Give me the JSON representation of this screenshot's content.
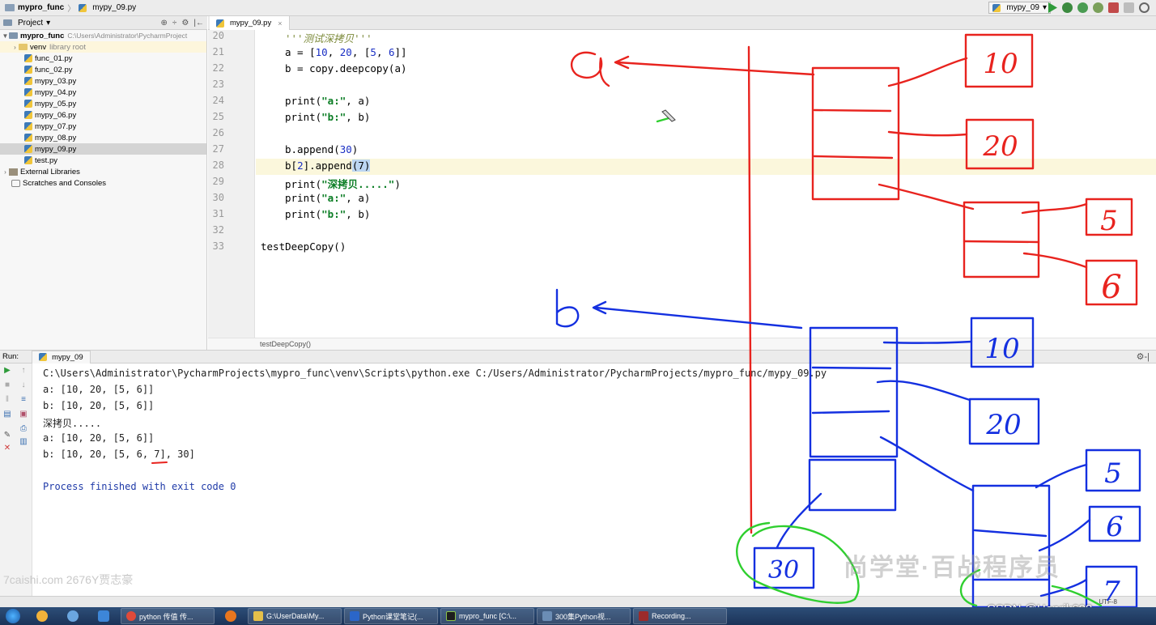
{
  "topbar": {
    "crumbs": [
      "mypro_func",
      "mypy_09.py"
    ],
    "run_config": "mypy_09",
    "run_config_arrow": "▾"
  },
  "project": {
    "header_label": "Project",
    "header_arrow": "▾",
    "tools": [
      "⊕",
      "÷",
      "⚙",
      "|←"
    ],
    "root_name": "mypro_func",
    "root_path": "C:\\Users\\Administrator\\PycharmProject",
    "venv_name": "venv",
    "venv_note": "library root",
    "files": [
      "func_01.py",
      "func_02.py",
      "mypy_03.py",
      "mypy_04.py",
      "mypy_05.py",
      "mypy_06.py",
      "mypy_07.py",
      "mypy_08.py",
      "mypy_09.py",
      "test.py"
    ],
    "external_libraries": "External Libraries",
    "scratches": "Scratches and Consoles"
  },
  "editor": {
    "tab_label": "mypy_09.py",
    "tab_close": "×",
    "line_numbers": [
      "20",
      "21",
      "22",
      "23",
      "24",
      "25",
      "26",
      "27",
      "28",
      "29",
      "30",
      "31",
      "32",
      "33"
    ],
    "code": {
      "l20": "'''测试深拷贝'''",
      "l21_a": "a = [",
      "l21_n1": "10",
      "l21_s1": ", ",
      "l21_n2": "20",
      "l21_s2": ", [",
      "l21_n3": "5",
      "l21_s3": ", ",
      "l21_n4": "6",
      "l21_end": "]]",
      "l22": "b = copy.deepcopy(a)",
      "l24_a": "print(",
      "l24_str": "\"a:\"",
      "l24_end": ", a)",
      "l25_a": "print(",
      "l25_str": "\"b:\"",
      "l25_end": ", b)",
      "l27_a": "b.append(",
      "l27_n": "30",
      "l27_end": ")",
      "l28_a": "b[",
      "l28_n": "2",
      "l28_b": "].append",
      "l28_sel": "(7)",
      "l29_a": "print(",
      "l29_str": "\"深拷贝.....\"",
      "l29_end": ")",
      "l30_a": "print(",
      "l30_str": "\"a:\"",
      "l30_end": ", a)",
      "l31_a": "print(",
      "l31_str": "\"b:\"",
      "l31_end": ", b)",
      "l33": "testDeepCopy()"
    },
    "breadcrumb": "testDeepCopy()"
  },
  "run": {
    "label": "Run:",
    "tab": "mypy_09",
    "gear": "⚙-|",
    "output": [
      "C:\\Users\\Administrator\\PycharmProjects\\mypro_func\\venv\\Scripts\\python.exe C:/Users/Administrator/PycharmProjects/mypro_func/mypy_09.py",
      "a: [10, 20, [5, 6]]",
      "b: [10, 20, [5, 6]]",
      "深拷贝.....",
      "a: [10, 20, [5, 6]]",
      "b: [10, 20, [5, 6, 7], 30]",
      "",
      "Process finished with exit code 0"
    ]
  },
  "annotations": {
    "label_a": "a",
    "label_b": "b",
    "red_values": [
      "10",
      "20",
      "5",
      "6"
    ],
    "blue_values": [
      "10",
      "20",
      "5",
      "6",
      "7"
    ],
    "green_value": "30"
  },
  "watermarks": {
    "left": "7caishi.com 2676Y贾志豪",
    "center": "尚学堂·百战程序员",
    "csdn": "CSDN @Henrik698",
    "status_text": "UTF-8"
  },
  "taskbar": {
    "tasks": [
      {
        "label": "python 传值 传...",
        "color": "#e04a3a"
      },
      {
        "label": "G:\\UserData\\My...",
        "color": "#e5c04a"
      },
      {
        "label": "Python课堂笔记(...",
        "color": "#2b66c9"
      },
      {
        "label": "mypro_func [C:\\...",
        "color": "#1e1e1e"
      },
      {
        "label": "300集Python视...",
        "color": "#6b8db5"
      },
      {
        "label": "Recording...",
        "color": "#9b2b2b"
      }
    ]
  },
  "colors": {
    "red_ink": "#e8231e",
    "blue_ink": "#1430e0",
    "green_ink": "#2fcf2f"
  }
}
